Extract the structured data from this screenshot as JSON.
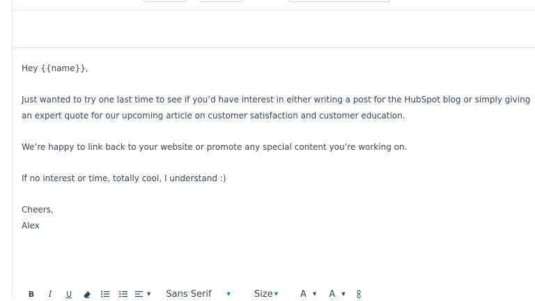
{
  "email": {
    "greeting": "Hey {{name}},",
    "paragraph1": "Just wanted to try one last time to see if you’d have interest in either writing a post for the HubSpot blog or simply giving an expert quote for our upcoming article on customer satisfaction and customer education.",
    "paragraph2": "We’re happy to link back to your website or promote any special content you’re working on.",
    "paragraph3": "If no interest or time, totally cool, I understand :)",
    "signoff": "Cheers,",
    "signature": "Alex"
  },
  "toolbar": {
    "bold": "B",
    "italic": "I",
    "underline": "U",
    "font_family": "Sans Serif",
    "font_size": "Size",
    "text_color": "A",
    "highlight_color": "A",
    "colors": {
      "text": "#33475b",
      "accent": "#0091ae",
      "border": "#dfe3eb"
    }
  }
}
